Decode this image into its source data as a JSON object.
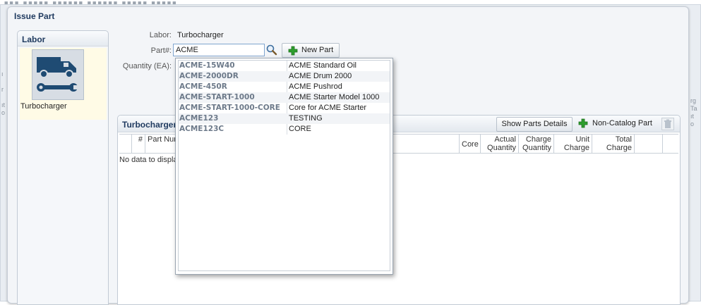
{
  "dialog": {
    "title": "Issue Part"
  },
  "labor_panel": {
    "heading": "Labor",
    "item_label": "Turbocharger"
  },
  "form": {
    "labor_label": "Labor:",
    "labor_value": "Turbocharger",
    "part_label": "Part#:",
    "part_value": "ACME",
    "quantity_label": "Quantity (EA):",
    "new_part_label": "New Part"
  },
  "dropdown": {
    "items": [
      {
        "code": "ACME-15W40",
        "description": "ACME Standard Oil"
      },
      {
        "code": "ACME-2000DR",
        "description": "ACME Drum 2000"
      },
      {
        "code": "ACME-450R",
        "description": "ACME Pushrod"
      },
      {
        "code": "ACME-START-1000",
        "description": "ACME Starter Model 1000"
      },
      {
        "code": "ACME-START-1000-CORE",
        "description": "Core for ACME Starter"
      },
      {
        "code": "ACME123",
        "description": "TESTING"
      },
      {
        "code": "ACME123C",
        "description": "CORE"
      }
    ]
  },
  "table": {
    "title": "Turbocharger",
    "show_details_label": "Show Parts Details",
    "non_catalog_label": "Non-Catalog Part",
    "columns": {
      "num": "#",
      "part_number": "Part Num",
      "core": "Core",
      "actual_quantity": "Actual Quantity",
      "charge_quantity": "Charge Quantity",
      "unit_charge": "Unit Charge",
      "total_charge": "Total Charge"
    },
    "empty_text": "No data to displa"
  },
  "colors": {
    "accent": "#1f3a5f",
    "input_border": "#7fa5cf",
    "plus_green": "#2e9e2e"
  },
  "icons": [
    "truck-wrench-icon",
    "search-icon",
    "plus-icon",
    "trash-icon"
  ]
}
